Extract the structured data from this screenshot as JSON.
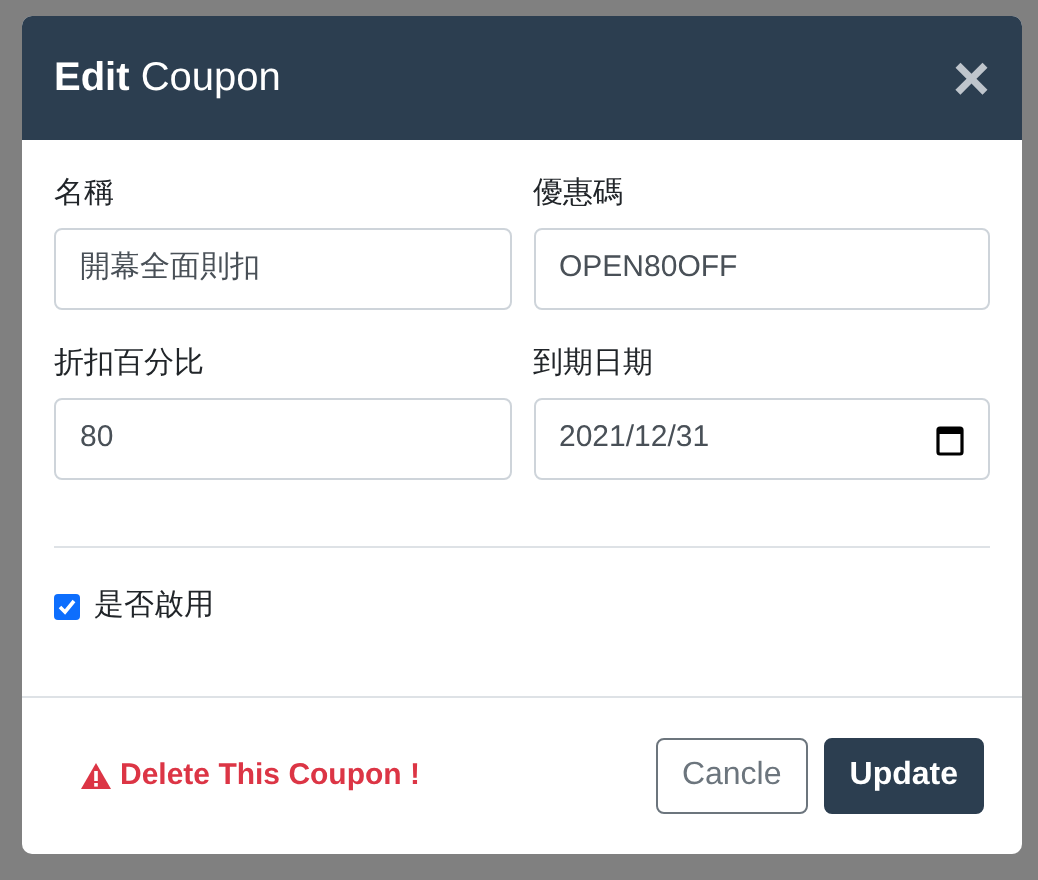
{
  "dialog": {
    "title": "**Edit** Coupon",
    "close": "×"
  },
  "fields": [
    {
      "kind": "text",
      "label": "名稱",
      "value": "開幕全面則扣"
    },
    {
      "kind": "text",
      "label": "優惠碼",
      "value": "OPEN80OFF"
    },
    {
      "kind": "text",
      "label": "折扣百分比",
      "value": "80"
    },
    {
      "kind": "date",
      "label": "到期日期",
      "value": "2021/12/31"
    }
  ],
  "enabled": {
    "label": "是否啟用",
    "checked": true
  },
  "footer": {
    "delete_link": "Delete This Coupon !",
    "buttons": [
      {
        "kind": "secondary",
        "label": "Cancle"
      },
      {
        "kind": "primary",
        "label": "Update"
      }
    ]
  }
}
